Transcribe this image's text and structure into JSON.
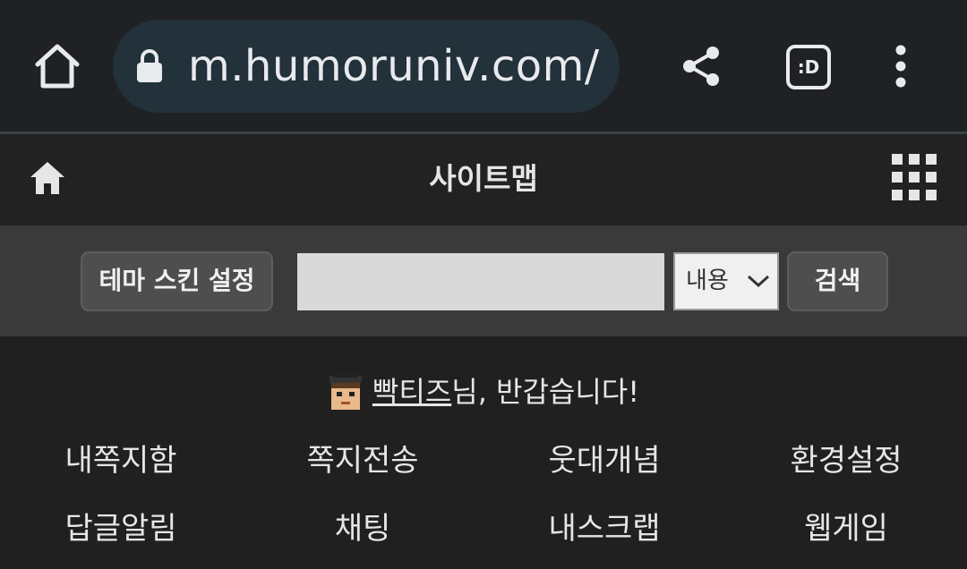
{
  "browser": {
    "url": "m.humoruniv.com/",
    "tab_label": ":D"
  },
  "header": {
    "title": "사이트맵"
  },
  "search": {
    "theme_button": "테마 스킨 설정",
    "input_value": "",
    "select_value": "내용",
    "search_button": "검색"
  },
  "welcome": {
    "username": "빡티즈",
    "suffix": "님, 반갑습니다!"
  },
  "links": {
    "row1": [
      "내쪽지함",
      "쪽지전송",
      "웃대개념",
      "환경설정"
    ],
    "row2": [
      "답글알림",
      "채팅",
      "내스크랩",
      "웹게임"
    ]
  },
  "colors": {
    "background": "#202020",
    "browser_bar": "#202124",
    "url_pill": "#22313a",
    "search_bar": "#3a3a3a"
  }
}
